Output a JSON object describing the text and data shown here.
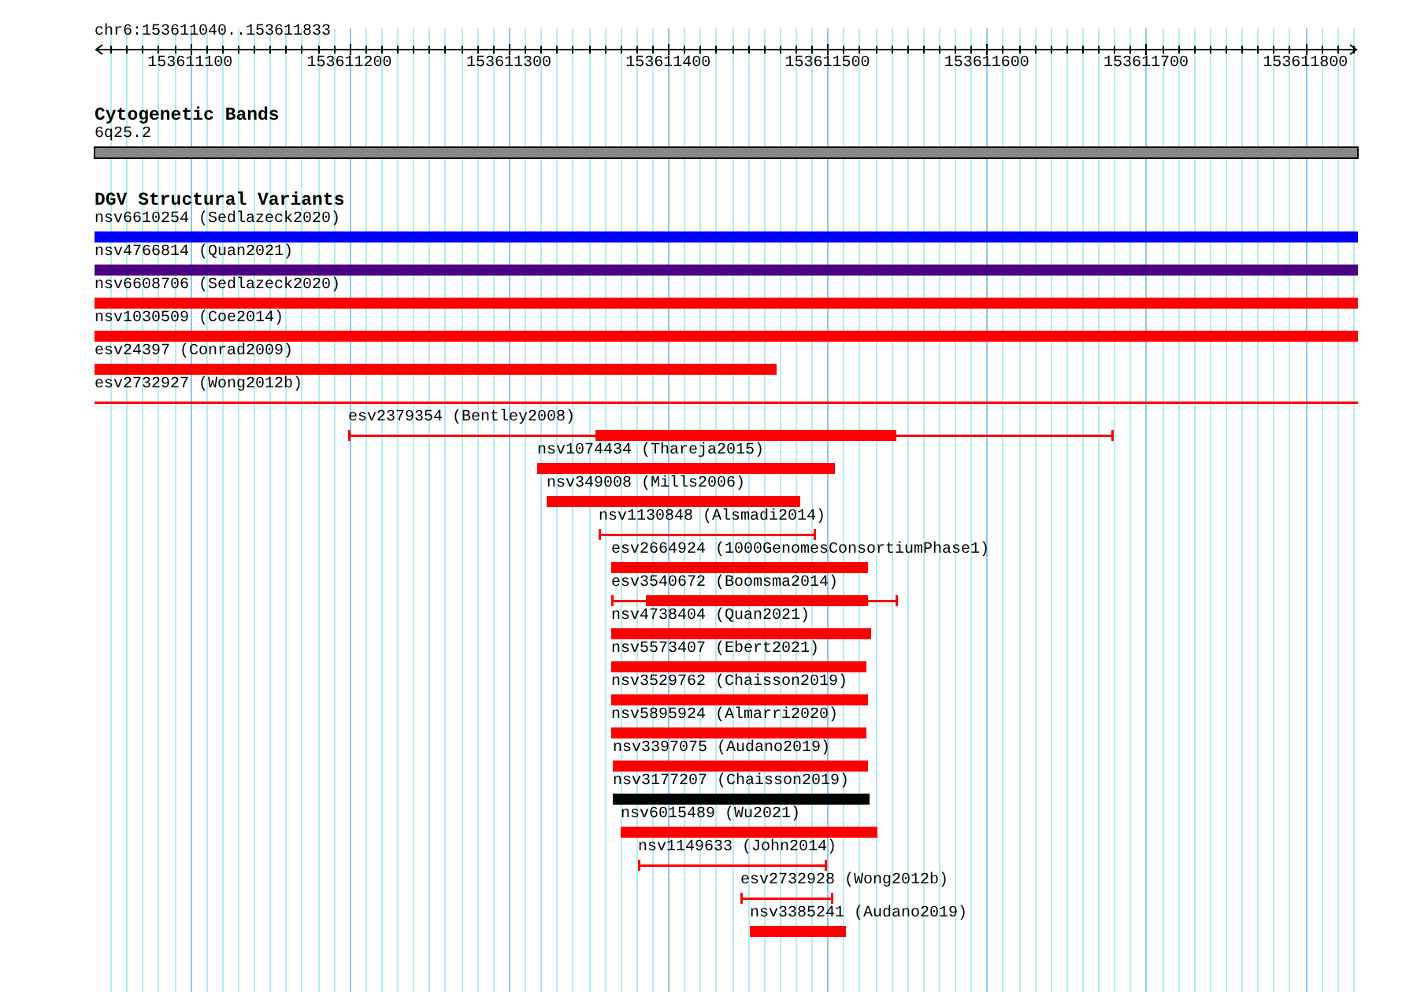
{
  "location": "chr6:153611040..153611833",
  "ruler": {
    "labels": [
      "153611100",
      "153611200",
      "153611300",
      "153611400",
      "153611500",
      "153611600",
      "153611700",
      "153611800"
    ]
  },
  "cytoband_track": {
    "title": "Cytogenetic Bands",
    "band": {
      "label": "6q25.2"
    }
  },
  "dgv_track": {
    "title": "DGV Structural Variants",
    "features": [
      {
        "label": "nsv6610254 (Sedlazeck2020)",
        "kind": "bar",
        "color": "#0000ff"
      },
      {
        "label": "nsv4766814 (Quan2021)",
        "kind": "bar",
        "color": "#4b0082"
      },
      {
        "label": "nsv6608706 (Sedlazeck2020)",
        "kind": "bar",
        "color": "#ff0000"
      },
      {
        "label": "nsv1030509 (Coe2014)",
        "kind": "bar",
        "color": "#ff0000"
      },
      {
        "label": "esv24397 (Conrad2009)",
        "kind": "bar",
        "color": "#ff0000"
      },
      {
        "label": "esv2732927 (Wong2012b)",
        "kind": "line",
        "color": "#ff0000"
      },
      {
        "label": "esv2379354 (Bentley2008)",
        "kind": "line-bar",
        "color": "#ff0000"
      },
      {
        "label": "nsv1074434 (Thareja2015)",
        "kind": "bar",
        "color": "#ff0000"
      },
      {
        "label": "nsv349008 (Mills2006)",
        "kind": "bar",
        "color": "#ff0000"
      },
      {
        "label": "nsv1130848 (Alsmadi2014)",
        "kind": "line",
        "color": "#ff0000"
      },
      {
        "label": "esv2664924 (1000GenomesConsortiumPhase1)",
        "kind": "bar",
        "color": "#ff0000"
      },
      {
        "label": "esv3540672 (Boomsma2014)",
        "kind": "line-bar",
        "color": "#ff0000"
      },
      {
        "label": "nsv4738404 (Quan2021)",
        "kind": "bar",
        "color": "#ff0000"
      },
      {
        "label": "nsv5573407 (Ebert2021)",
        "kind": "bar",
        "color": "#ff0000"
      },
      {
        "label": "nsv3529762 (Chaisson2019)",
        "kind": "bar",
        "color": "#ff0000"
      },
      {
        "label": "nsv5895924 (Almarri2020)",
        "kind": "bar",
        "color": "#ff0000"
      },
      {
        "label": "nsv3397075 (Audano2019)",
        "kind": "bar",
        "color": "#ff0000"
      },
      {
        "label": "nsv3177207 (Chaisson2019)",
        "kind": "bar",
        "color": "#000000"
      },
      {
        "label": "nsv6015489 (Wu2021)",
        "kind": "bar",
        "color": "#ff0000"
      },
      {
        "label": "nsv1149633 (John2014)",
        "kind": "line",
        "color": "#ff0000"
      },
      {
        "label": "esv2732928 (Wong2012b)",
        "kind": "line",
        "color": "#ff0000"
      },
      {
        "label": "nsv3385241 (Audano2019)",
        "kind": "bar",
        "color": "#ff0000"
      }
    ]
  }
}
